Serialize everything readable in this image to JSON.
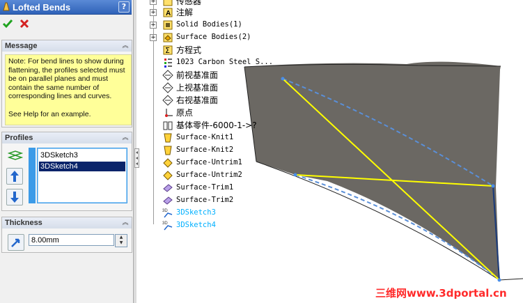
{
  "property_manager": {
    "title": "Lofted Bends",
    "help_label": "?",
    "ok_icon": "check-icon",
    "cancel_icon": "x-icon",
    "message": {
      "header": "Message",
      "text": "Note: For bend lines to show during flattening, the profiles selected must be on parallel planes and must contain the same number of corresponding lines and curves.\n\nSee Help for an example."
    },
    "profiles": {
      "header": "Profiles",
      "items": [
        "3DSketch3",
        "3DSketch4"
      ],
      "selected": "3DSketch4"
    },
    "thickness": {
      "header": "Thickness",
      "value": "8.00mm"
    }
  },
  "tree": {
    "nodes": [
      {
        "label": "传感器",
        "icon": "sensor-icon",
        "expandable": true,
        "style": "cjk"
      },
      {
        "label": "注解",
        "icon": "annotations-icon",
        "expandable": true,
        "style": "cjk"
      },
      {
        "label": "Solid Bodies(1)",
        "icon": "solid-bodies-icon",
        "expandable": true,
        "style": "mono"
      },
      {
        "label": "Surface Bodies(2)",
        "icon": "surface-bodies-icon",
        "expandable": true,
        "style": "mono"
      },
      {
        "label": "方程式",
        "icon": "equations-icon",
        "expandable": false,
        "style": "cjk"
      },
      {
        "label": "1023 Carbon Steel S...",
        "icon": "material-icon",
        "expandable": false,
        "style": "mono"
      },
      {
        "label": "前视基准面",
        "icon": "plane-icon",
        "expandable": false,
        "style": "cjk"
      },
      {
        "label": "上视基准面",
        "icon": "plane-icon",
        "expandable": false,
        "style": "cjk"
      },
      {
        "label": "右视基准面",
        "icon": "plane-icon",
        "expandable": false,
        "style": "cjk"
      },
      {
        "label": "原点",
        "icon": "origin-icon",
        "expandable": false,
        "style": "cjk"
      },
      {
        "label": "基体零件-6000-1->?",
        "icon": "base-part-icon",
        "expandable": false,
        "style": "cjk"
      },
      {
        "label": "Surface-Knit1",
        "icon": "surface-knit-icon",
        "expandable": false,
        "style": "mono"
      },
      {
        "label": "Surface-Knit2",
        "icon": "surface-knit-icon",
        "expandable": false,
        "style": "mono"
      },
      {
        "label": "Surface-Untrim1",
        "icon": "surface-untrim-icon",
        "expandable": false,
        "style": "mono"
      },
      {
        "label": "Surface-Untrim2",
        "icon": "surface-untrim-icon",
        "expandable": false,
        "style": "mono"
      },
      {
        "label": "Surface-Trim1",
        "icon": "surface-trim-icon",
        "expandable": false,
        "style": "mono"
      },
      {
        "label": "Surface-Trim2",
        "icon": "surface-trim-icon",
        "expandable": false,
        "style": "mono"
      },
      {
        "label": "3DSketch3",
        "icon": "3dsketch-icon",
        "expandable": false,
        "style": "sketch"
      },
      {
        "label": "3DSketch4",
        "icon": "3dsketch-icon",
        "expandable": false,
        "style": "sketch"
      }
    ]
  },
  "watermark": "三维网www.3dportal.cn",
  "colors": {
    "title_bar": "#2f62b8",
    "message_bg": "#ffff99",
    "selection": "#0a246a",
    "sketch_text": "#00b0ff",
    "part_face": "#6b6863",
    "bend_lines": "#ffff00",
    "watermark": "#ff2a2a"
  }
}
